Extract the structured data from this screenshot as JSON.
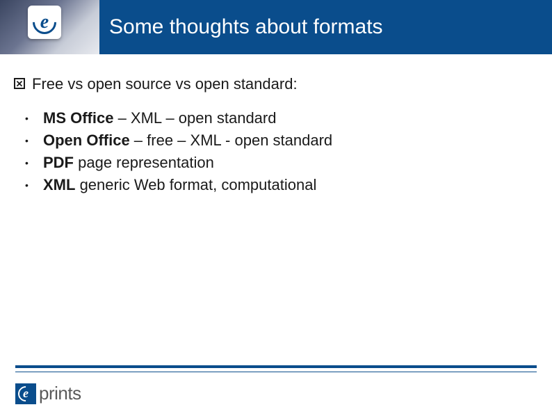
{
  "header": {
    "title": "Some thoughts about formats",
    "logo_letter": "e"
  },
  "content": {
    "heading": "Free vs open source vs open standard:",
    "bullets": [
      {
        "bold": "MS Office",
        "rest": " – XML – open standard"
      },
      {
        "bold": "Open Office",
        "rest": " – free – XML - open standard"
      },
      {
        "bold": "PDF",
        "rest": " page representation"
      },
      {
        "bold": "XML",
        "rest": " generic Web format, computational"
      }
    ]
  },
  "footer": {
    "logo_letter": "e",
    "brand_text": "prints"
  }
}
